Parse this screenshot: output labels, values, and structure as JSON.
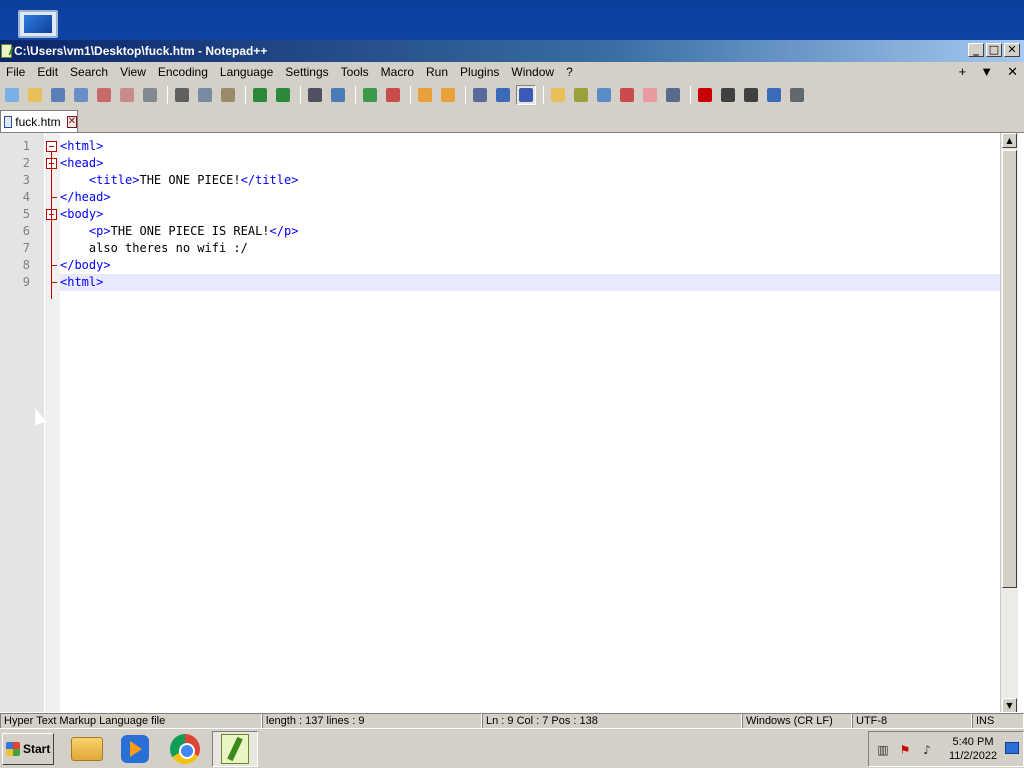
{
  "window": {
    "title": "C:\\Users\\vm1\\Desktop\\fuck.htm - Notepad++",
    "minimize": "_",
    "maximize": "□",
    "close": "✕"
  },
  "menu": {
    "items": [
      "File",
      "Edit",
      "Search",
      "View",
      "Encoding",
      "Language",
      "Settings",
      "Tools",
      "Macro",
      "Run",
      "Plugins",
      "Window",
      "?"
    ],
    "right": [
      "+",
      "▼",
      "✕"
    ]
  },
  "toolbar": {
    "icons": [
      "new-file-icon",
      "open-file-icon",
      "save-icon",
      "save-all-icon",
      "close-icon",
      "close-all-icon",
      "print-icon",
      "cut-icon",
      "copy-icon",
      "paste-icon",
      "undo-icon",
      "redo-icon",
      "find-icon",
      "replace-icon",
      "zoom-in-icon",
      "zoom-out-icon",
      "sync-v-icon",
      "sync-h-icon",
      "word-wrap-icon",
      "show-all-chars-icon",
      "indent-guide-icon",
      "udl-icon",
      "doc-map-icon",
      "doc-list-icon",
      "function-list-icon",
      "folder-workspace-icon",
      "monitoring-icon",
      "record-macro-icon",
      "stop-macro-icon",
      "play-macro-icon",
      "run-macro-multiple-icon",
      "save-macro-icon"
    ]
  },
  "tab": {
    "label": "fuck.htm",
    "close": "✕"
  },
  "editor": {
    "lines": [
      {
        "n": "1",
        "parts": [
          {
            "t": "tag",
            "v": "<html>"
          }
        ]
      },
      {
        "n": "2",
        "parts": [
          {
            "t": "tag",
            "v": "<head>"
          }
        ]
      },
      {
        "n": "3",
        "parts": [
          {
            "t": "txt",
            "v": "    "
          },
          {
            "t": "tag",
            "v": "<title>"
          },
          {
            "t": "txt",
            "v": "THE ONE PIECE!"
          },
          {
            "t": "tag",
            "v": "</title>"
          }
        ]
      },
      {
        "n": "4",
        "parts": [
          {
            "t": "tag",
            "v": "</head>"
          }
        ]
      },
      {
        "n": "5",
        "parts": [
          {
            "t": "tag",
            "v": "<body>"
          }
        ]
      },
      {
        "n": "6",
        "parts": [
          {
            "t": "txt",
            "v": "    "
          },
          {
            "t": "tag",
            "v": "<p>"
          },
          {
            "t": "txt",
            "v": "THE ONE PIECE IS REAL!"
          },
          {
            "t": "tag",
            "v": "</p>"
          }
        ]
      },
      {
        "n": "7",
        "parts": [
          {
            "t": "txt",
            "v": "    also theres no wifi :/"
          }
        ]
      },
      {
        "n": "8",
        "parts": [
          {
            "t": "tag",
            "v": "</body>"
          }
        ]
      },
      {
        "n": "9",
        "parts": [
          {
            "t": "tag",
            "v": "<html>"
          }
        ]
      }
    ],
    "current_line": 9
  },
  "statusbar": {
    "cells": [
      "Hyper Text Markup Language file",
      "length : 137    lines : 9",
      "Ln : 9    Col : 7    Pos : 138",
      "Windows (CR LF)",
      "UTF-8",
      "INS"
    ]
  },
  "taskbar": {
    "start_label": "Start",
    "apps": [
      "explorer-icon",
      "media-player-icon",
      "chrome-icon",
      "notepad-plus-plus-icon"
    ],
    "active_app": "notepad-plus-plus-icon",
    "clock_time": "5:40 PM",
    "clock_date": "11/2/2022"
  }
}
